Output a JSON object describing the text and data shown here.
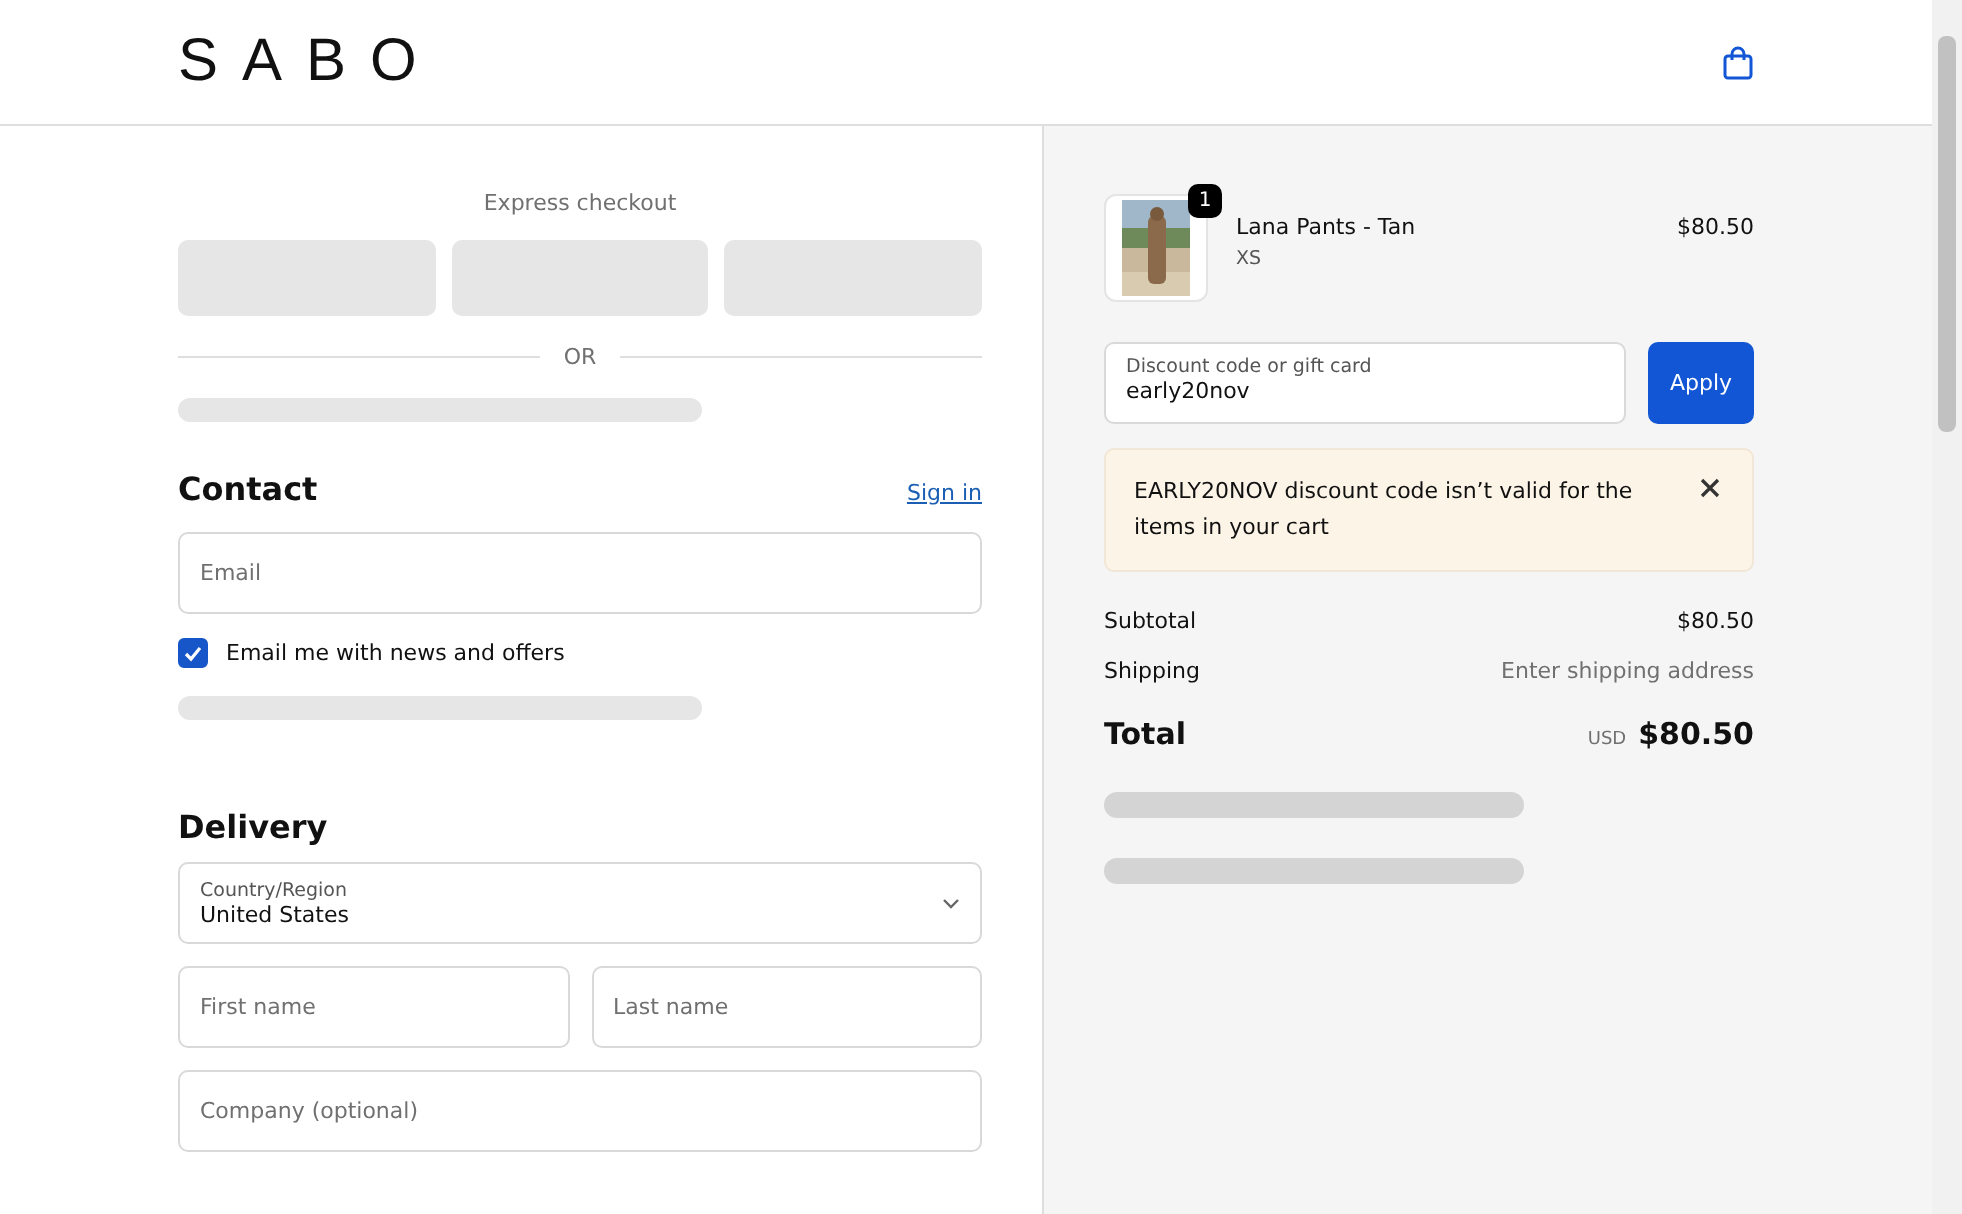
{
  "header": {
    "logo": "SABO"
  },
  "checkout": {
    "express_title": "Express checkout",
    "divider": "OR",
    "contact": {
      "title": "Contact",
      "sign_in": "Sign in",
      "email_placeholder": "Email",
      "newsletter": {
        "label": "Email me with news and offers",
        "checked": true
      }
    },
    "delivery": {
      "title": "Delivery",
      "country": {
        "label": "Country/Region",
        "value": "United States"
      },
      "fields": [
        {
          "placeholder": "First name",
          "half": true
        },
        {
          "placeholder": "Last name",
          "half": true
        },
        {
          "placeholder": "Company (optional)",
          "half": false
        }
      ]
    }
  },
  "summary": {
    "item": {
      "quantity": "1",
      "name": "Lana Pants - Tan",
      "variant": "XS",
      "price": "$80.50"
    },
    "discount": {
      "label": "Discount code or gift card",
      "value": "early20nov",
      "button": "Apply"
    },
    "error": "EARLY20NOV discount code isn’t valid for the items in your cart",
    "rows": [
      {
        "label": "Subtotal",
        "value": "$80.50",
        "muted": false
      },
      {
        "label": "Shipping",
        "value": "Enter shipping address",
        "muted": true
      }
    ],
    "total": {
      "label": "Total",
      "currency": "USD",
      "value": "$80.50"
    }
  }
}
